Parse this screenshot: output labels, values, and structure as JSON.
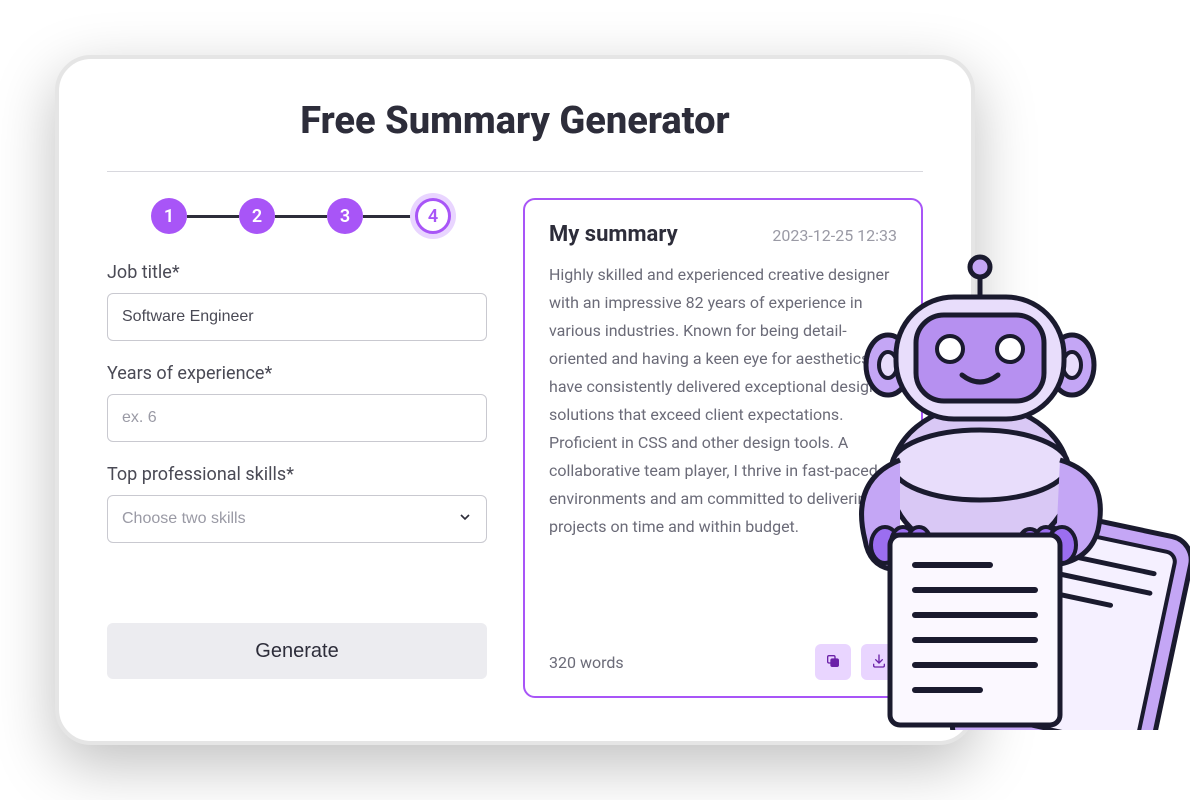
{
  "title": "Free Summary Generator",
  "stepper": {
    "steps": [
      "1",
      "2",
      "3",
      "4"
    ],
    "active_index": 3
  },
  "form": {
    "job_title": {
      "label": "Job title*",
      "value": "Software Engineer"
    },
    "years": {
      "label": "Years of experience*",
      "value": "",
      "placeholder": "ex. 6"
    },
    "skills": {
      "label": "Top professional skills*",
      "placeholder": "Choose two skills"
    },
    "generate_label": "Generate"
  },
  "summary": {
    "heading": "My summary",
    "timestamp": "2023-12-25 12:33",
    "body": "Highly skilled and experienced creative designer with an impressive 82 years of experience in various industries. Known for being detail-oriented and having a keen eye for aesthetics, I have consistently delivered exceptional design solutions that exceed client expectations. Proficient in CSS and other design tools. A collaborative team player, I thrive in fast-paced environments and am committed to delivering projects on time and within budget.",
    "word_count": "320 words"
  },
  "colors": {
    "accent": "#a855f7",
    "accent_light": "#e9d5ff"
  }
}
